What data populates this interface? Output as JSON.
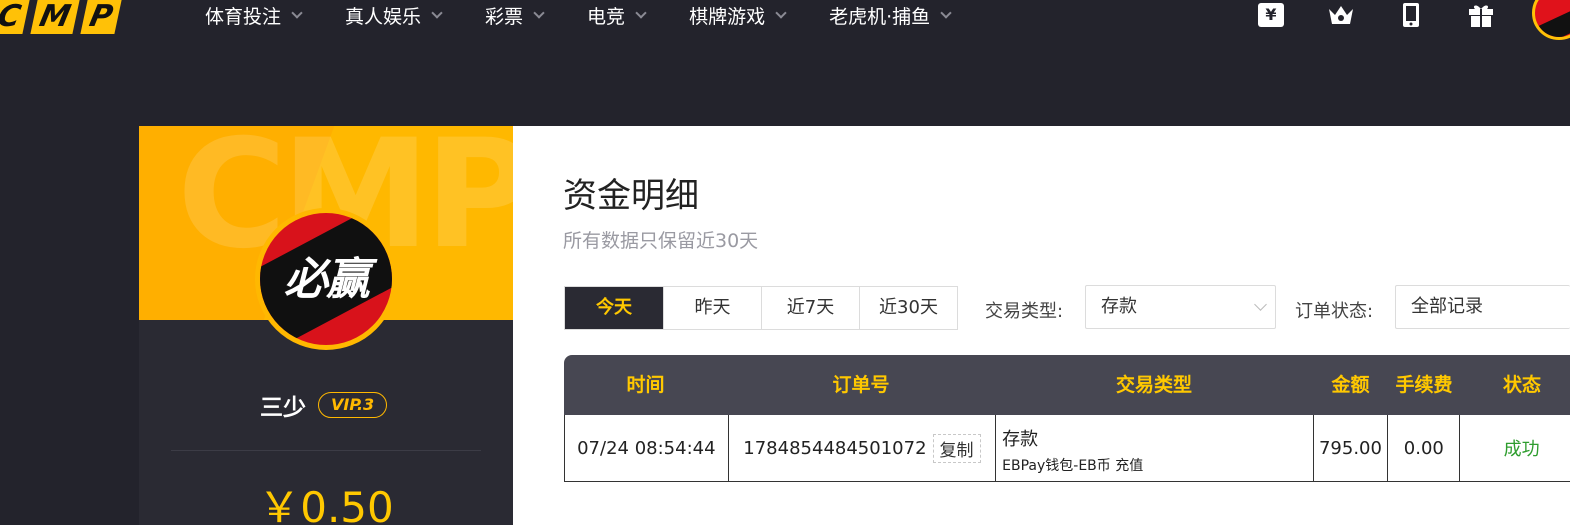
{
  "logo": {
    "letters": [
      "C",
      "M",
      "P"
    ]
  },
  "nav": {
    "items": [
      {
        "label": "体育投注"
      },
      {
        "label": "真人娱乐"
      },
      {
        "label": "彩票"
      },
      {
        "label": "电竞"
      },
      {
        "label": "棋牌游戏"
      },
      {
        "label": "老虎机·捕鱼"
      }
    ]
  },
  "profile": {
    "avatar_text": "必赢",
    "name": "三少",
    "vip": "VIP.3",
    "balance": "￥0.50"
  },
  "page": {
    "title": "资金明细",
    "subtitle": "所有数据只保留近30天"
  },
  "filters": {
    "tabs": [
      "今天",
      "昨天",
      "近7天",
      "近30天"
    ],
    "active_tab": "今天",
    "type_label": "交易类型:",
    "type_value": "存款",
    "status_label": "订单状态:",
    "status_value": "全部记录"
  },
  "table": {
    "headers": [
      "时间",
      "订单号",
      "交易类型",
      "金额",
      "手续费",
      "状态"
    ],
    "rows": [
      {
        "time": "07/24 08:54:44",
        "order_no": "1784854484501072",
        "copy_label": "复制",
        "type": "存款",
        "type_detail": "EBPay钱包-EB币 充值",
        "amount": "795.00",
        "fee": "0.00",
        "status": "成功"
      }
    ]
  },
  "colors": {
    "accent": "#ffc800",
    "dark": "#23232c",
    "success": "#2e9d2e"
  },
  "icons": [
    "ticket-icon",
    "crown-icon",
    "phone-icon",
    "gift-icon"
  ]
}
